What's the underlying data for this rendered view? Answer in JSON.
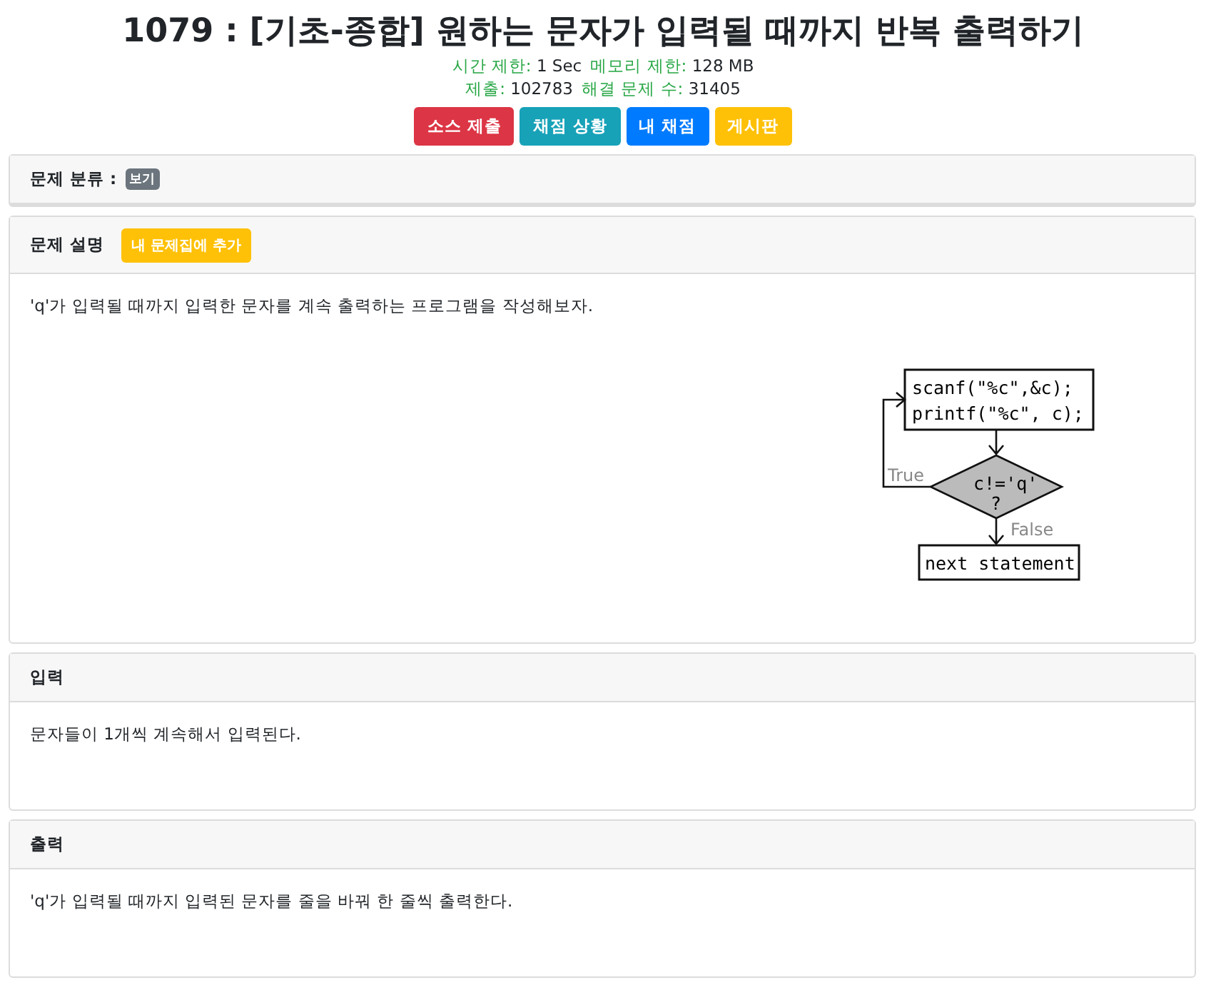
{
  "title": "1079 : [기초-종합] 원하는 문자가 입력될 때까지 반복 출력하기",
  "limits": [
    {
      "label": "시간 제한:",
      "value": "1 Sec"
    },
    {
      "label": "메모리 제한:",
      "value": "128 MB"
    }
  ],
  "stats": [
    {
      "label": "제출:",
      "value": "102783"
    },
    {
      "label": "해결 문제 수:",
      "value": "31405"
    }
  ],
  "buttons": [
    {
      "label": "소스 제출",
      "color": "#dc3545"
    },
    {
      "label": "채점 상황",
      "color": "#17a2b8"
    },
    {
      "label": "내 채점",
      "color": "#007bff"
    },
    {
      "label": "게시판",
      "color": "#ffc107"
    }
  ],
  "category": {
    "label": "문제 분류 :",
    "badge": "보기"
  },
  "description": {
    "heading": "문제 설명",
    "add_button": "내 문제집에 추가",
    "text": "'q'가 입력될 때까지 입력한 문자를 계속 출력하는 프로그램을 작성해보자.",
    "flowchart": {
      "box_lines": [
        "scanf(\"%c\",&c);",
        "printf(\"%c\", c);"
      ],
      "condition_lines": [
        "c!='q'",
        "?"
      ],
      "true_label": "True",
      "false_label": "False",
      "end_box": "next statement"
    }
  },
  "sections": [
    {
      "heading": "입력",
      "text": "문자들이 1개씩 계속해서 입력된다."
    },
    {
      "heading": "출력",
      "text": "'q'가 입력될 때까지 입력된 문자를 줄을 바꿔 한 줄씩 출력한다."
    }
  ]
}
